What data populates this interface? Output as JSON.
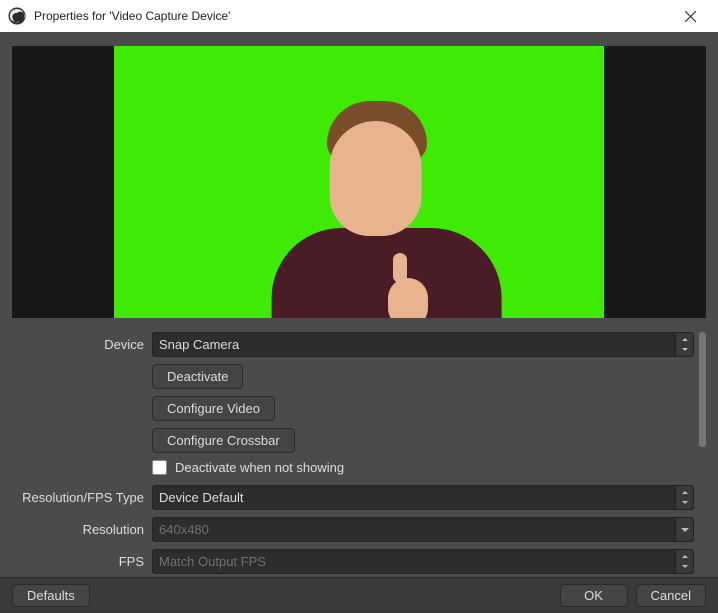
{
  "window": {
    "title": "Properties for 'Video Capture Device'"
  },
  "form": {
    "device": {
      "label": "Device",
      "value": "Snap Camera"
    },
    "buttons": {
      "deactivate": "Deactivate",
      "configure_video": "Configure Video",
      "configure_crossbar": "Configure Crossbar"
    },
    "checkbox": {
      "deactivate_when_not_showing": "Deactivate when not showing",
      "checked": false
    },
    "res_type": {
      "label": "Resolution/FPS Type",
      "value": "Device Default"
    },
    "resolution": {
      "label": "Resolution",
      "placeholder": "640x480"
    },
    "fps": {
      "label": "FPS",
      "placeholder": "Match Output FPS"
    }
  },
  "footer": {
    "defaults": "Defaults",
    "ok": "OK",
    "cancel": "Cancel"
  },
  "colors": {
    "green_screen": "#3fea05",
    "panel": "#4b4b4b",
    "button": "#444444"
  }
}
